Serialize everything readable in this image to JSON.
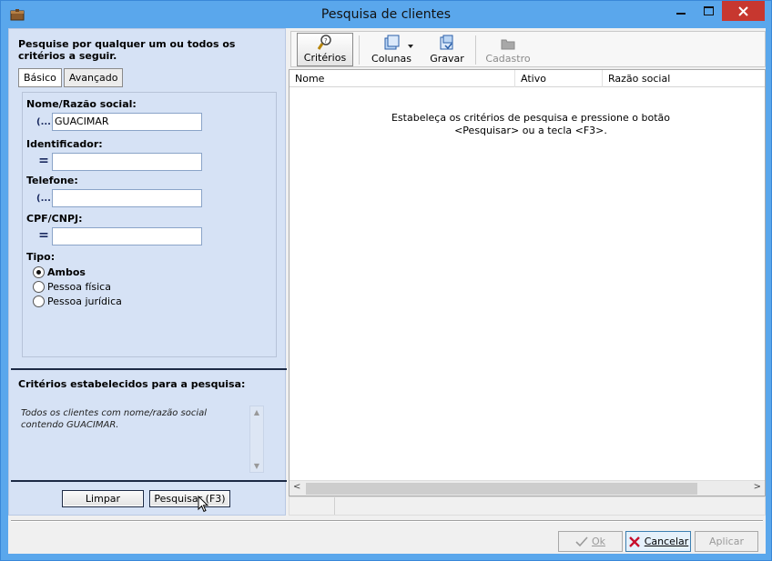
{
  "window": {
    "title": "Pesquisa de clientes"
  },
  "left": {
    "heading": "Pesquise por qualquer um ou todos os critérios a seguir.",
    "tabs": [
      {
        "label": "Básico",
        "active": true
      },
      {
        "label": "Avançado",
        "active": false
      }
    ],
    "fields": {
      "nome": {
        "label": "Nome/Razão social:",
        "operator": "(...)",
        "value": "GUACIMAR"
      },
      "identificador": {
        "label": "Identificador:",
        "operator": "=",
        "value": ""
      },
      "telefone": {
        "label": "Telefone:",
        "operator": "(...)",
        "value": ""
      },
      "cpf": {
        "label": "CPF/CNPJ:",
        "operator": "=",
        "value": ""
      }
    },
    "tipo": {
      "label": "Tipo:",
      "options": [
        {
          "label": "Ambos",
          "selected": true
        },
        {
          "label": "Pessoa física",
          "selected": false
        },
        {
          "label": "Pessoa jurídica",
          "selected": false
        }
      ]
    },
    "established_label": "Critérios estabelecidos para a pesquisa:",
    "established_text": "Todos os clientes com nome/razão social contendo GUACIMAR.",
    "clear_label": "Limpar",
    "search_label": "Pesquisar (F3)"
  },
  "toolbar": {
    "criterios": "Critérios",
    "colunas": "Colunas",
    "gravar": "Gravar",
    "cadastro": "Cadastro"
  },
  "grid": {
    "columns": [
      "Nome",
      "Ativo",
      "Razão social"
    ],
    "message": "Estabeleça os critérios de pesquisa e pressione o botão <Pesquisar> ou a tecla <F3>."
  },
  "dialog": {
    "ok": "Ok",
    "cancel": "Cancelar",
    "apply": "Aplicar"
  },
  "colors": {
    "titlebar": "#5aa7ec",
    "panel": "#d6e2f5",
    "close": "#c7372f"
  }
}
